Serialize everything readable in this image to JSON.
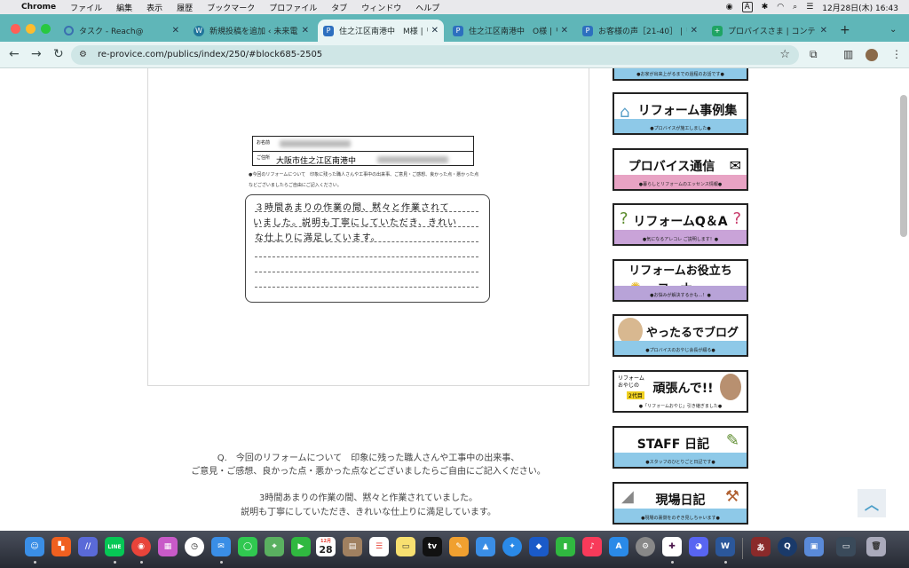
{
  "menubar": {
    "app": "Chrome",
    "items": [
      "ファイル",
      "編集",
      "表示",
      "履歴",
      "ブックマーク",
      "プロファイル",
      "タブ",
      "ウィンドウ",
      "ヘルプ"
    ],
    "input_mode": "A",
    "datetime": "12月28日(木) 16:43"
  },
  "tabs": [
    {
      "title": "タスク - Reach@",
      "icon": "circle-spinner-icon"
    },
    {
      "title": "新規投稿を追加 ‹ 未来電子",
      "icon": "wordpress-icon"
    },
    {
      "title": "住之江区南港中　M様 | リ",
      "icon": "provice-icon"
    },
    {
      "title": "住之江区南港中　O様 | リ",
      "icon": "provice-icon"
    },
    {
      "title": "お客様の声［21-40］ | リ",
      "icon": "provice-icon"
    },
    {
      "title": "プロバイスさま | コンテン",
      "icon": "green-plus-icon"
    }
  ],
  "active_tab_index": 2,
  "omnibox": {
    "url": "re-provice.com/publics/index/250/#block685-2505"
  },
  "survey_card": {
    "name_label": "お名前",
    "address_label": "ご住所",
    "address_value": "大阪市住之江区南港中",
    "question": "●今回のリフォームについて　印象に残った職人さんや工事中の出来事、ご意見・ご感想、良かった点・悪かった点などございましたらご自由にご記入ください。",
    "handwriting": [
      "３時間あまりの作業の間、黙々と作業されて",
      "いました。説明も丁寧にしていただき、きれい",
      "な仕上りに満足しています。"
    ]
  },
  "qa": {
    "question_line1": "Q.　今回のリフォームについて　印象に残った職人さんや工事中の出来事、",
    "question_line2": "ご意見・ご感想、良かった点・悪かった点などございましたらご自由にご記入ください。",
    "answer_line1": "3時間あまりの作業の間、黙々と作業されていました。",
    "answer_line2": "説明も丁寧にしていただき、きれいな仕上りに満足しています。"
  },
  "sidebar": {
    "top_caption": "●お家が出来上がるまでの過程のお話です●",
    "banners": [
      {
        "title": "リフォーム事例集",
        "sub": "●プロバイスが施工しました●",
        "color": "#8ec9e8",
        "icon": "house-icon"
      },
      {
        "title": "プロバイス通信",
        "sub": "●暮らしとリフォームのエッセンス情報●",
        "color": "#e8a3c4",
        "icon": "envelope-icon"
      },
      {
        "title": "リフォームQ＆A",
        "sub": "●気になるアレコレ ご説明します！●",
        "color": "#c9a3d8",
        "icon": "question-icon"
      },
      {
        "title": "リフォームお役立ちコーナー",
        "sub": "●お悩みが解決するかも…！●",
        "color": "#b8a3d8",
        "icon": "lightbulb-icon"
      },
      {
        "title": "やったるでブログ",
        "sub": "●プロバイスのおやじ会長が綴る●",
        "color": "#8ec9e8",
        "icon": "avatar-icon"
      },
      {
        "title": "頑張んで!!",
        "sub": "●「リフォームおやじ」引き継ぎました●",
        "color": "#ffffff",
        "icon": "avatar-icon"
      },
      {
        "title": "STAFF 日記",
        "sub": "●スタッフのひとりごと日記です●",
        "color": "#8ec9e8",
        "icon": "pen-icon"
      },
      {
        "title": "現場日記",
        "sub": "●現場の裏側をのぞき見しちゃいます●",
        "color": "#8ec9e8",
        "icon": "hammer-icon"
      }
    ],
    "oyaji_prefix": "リフォームおやじの",
    "oyaji_badge": "2代目"
  },
  "dock": {
    "calendar_month": "12月",
    "calendar_day": "28"
  }
}
